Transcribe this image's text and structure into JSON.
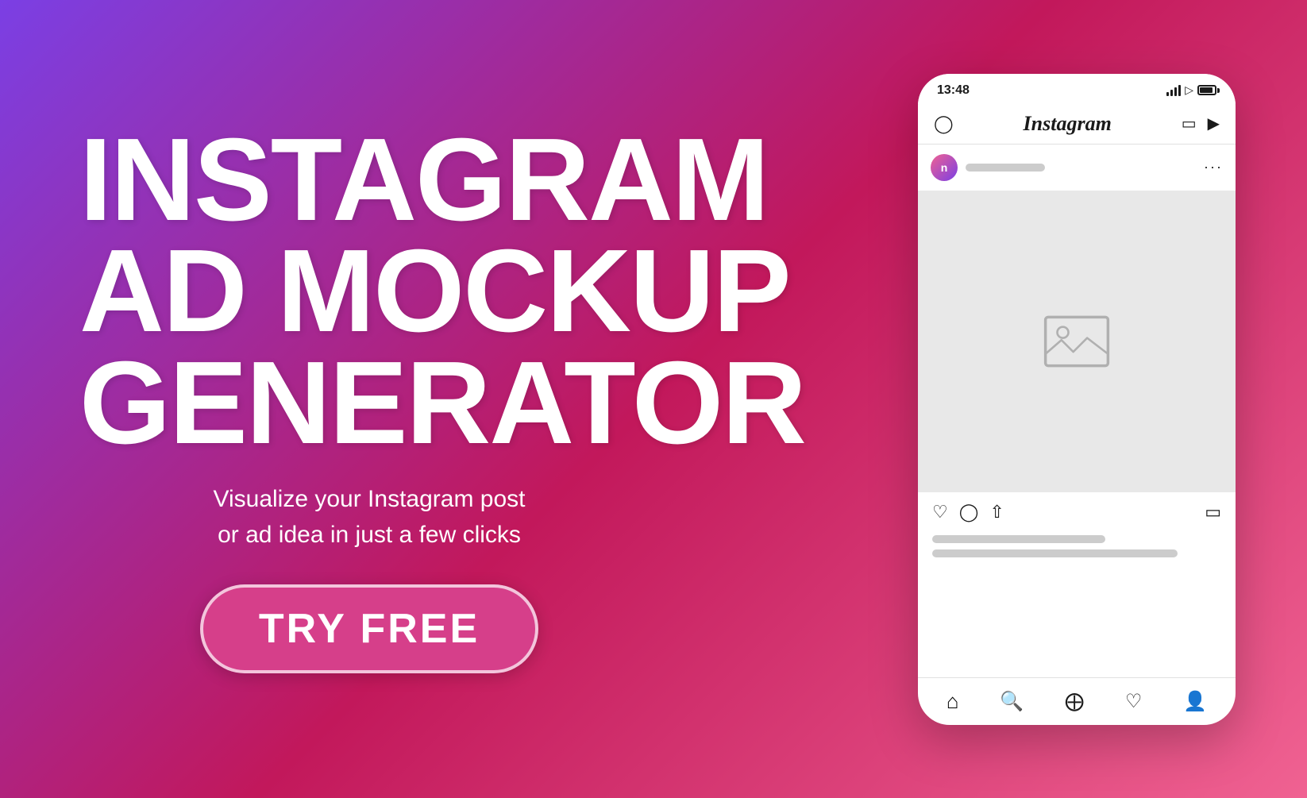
{
  "background": {
    "gradient_start": "#7b3fe4",
    "gradient_end": "#f06292"
  },
  "left": {
    "title_line1": "INSTAGRAM",
    "title_line2": "AD MOCKUP",
    "title_line3": "GENERATOR",
    "subtitle": "Visualize your Instagram post\nor ad idea in just a few clicks",
    "cta_label": "TRY FREE"
  },
  "phone": {
    "status_time": "13:48",
    "instagram_logo": "Instagram",
    "three_dots": "···"
  }
}
